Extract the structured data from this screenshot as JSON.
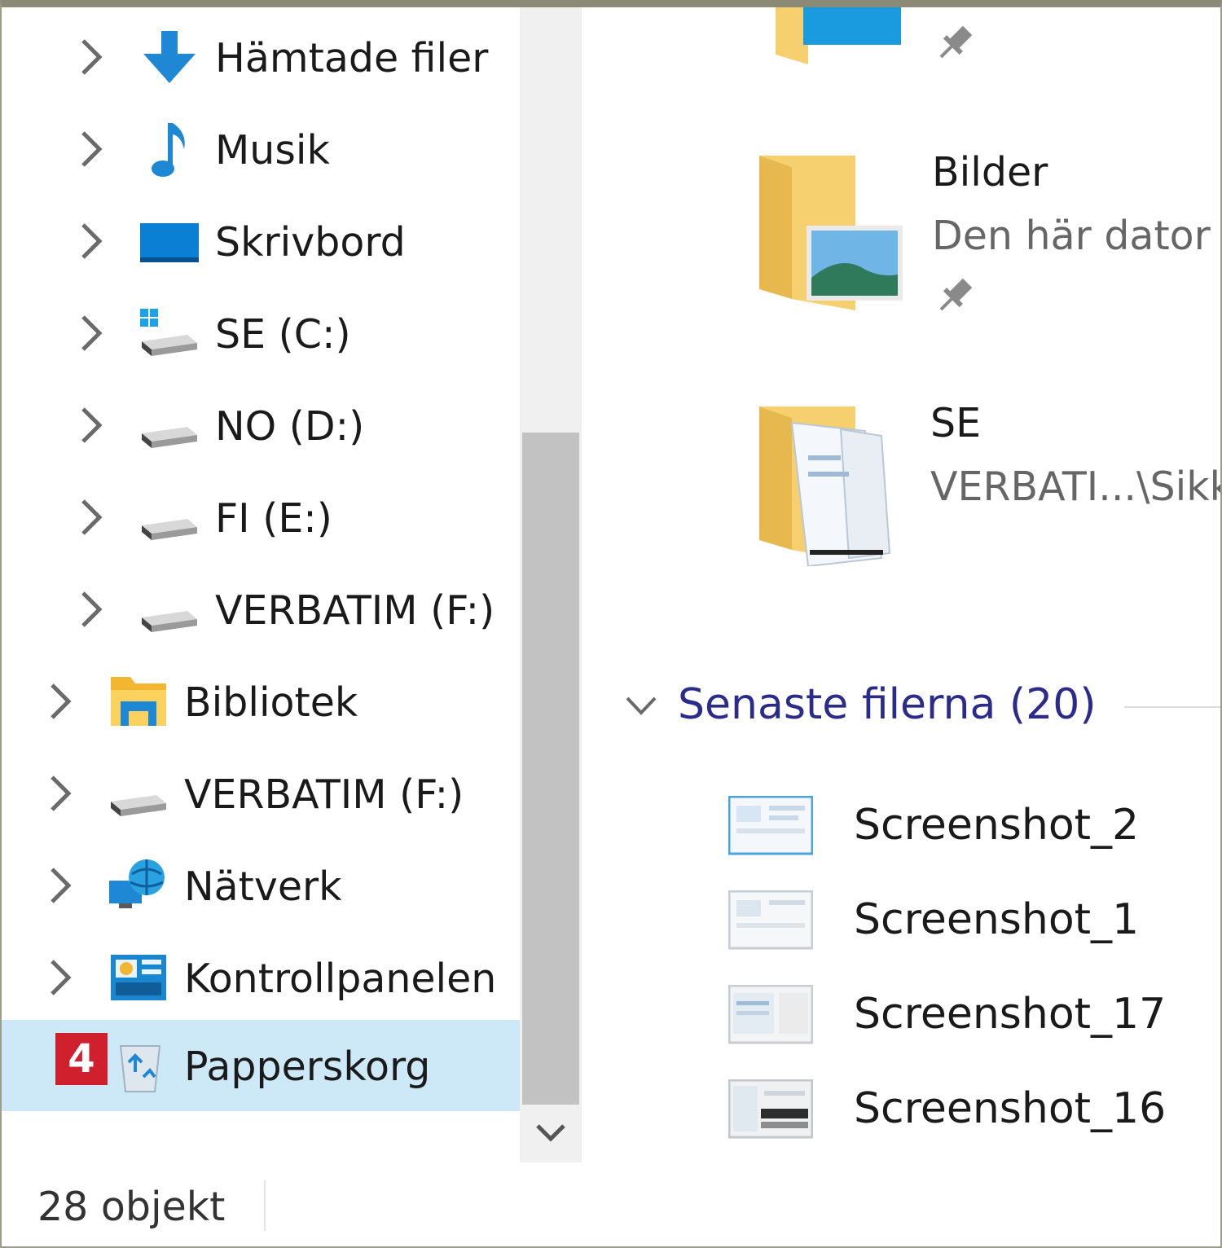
{
  "nav": {
    "items": [
      {
        "label": "Hämtade filer",
        "icon": "downloads-icon"
      },
      {
        "label": "Musik",
        "icon": "music-icon"
      },
      {
        "label": "Skrivbord",
        "icon": "desktop-icon"
      },
      {
        "label": "SE (C:)",
        "icon": "windows-drive-icon"
      },
      {
        "label": "NO (D:)",
        "icon": "drive-icon"
      },
      {
        "label": "FI (E:)",
        "icon": "drive-icon"
      },
      {
        "label": "VERBATIM (F:)",
        "icon": "drive-icon"
      },
      {
        "label": "Bibliotek",
        "icon": "libraries-icon"
      },
      {
        "label": "VERBATIM (F:)",
        "icon": "drive-icon"
      },
      {
        "label": "Nätverk",
        "icon": "network-icon"
      },
      {
        "label": "Kontrollpanelen",
        "icon": "control-panel-icon"
      },
      {
        "label": "Papperskorg",
        "icon": "recycle-bin-icon",
        "selected": true
      }
    ]
  },
  "annotation": {
    "badge": "4"
  },
  "quick_access": [
    {
      "title": "Bilder",
      "subtitle": "Den här dator"
    },
    {
      "title": "SE",
      "subtitle": "VERBATI...\\Sikk"
    }
  ],
  "recent": {
    "header": "Senaste filerna (20)",
    "files": [
      "Screenshot_2",
      "Screenshot_1",
      "Screenshot_17",
      "Screenshot_16"
    ]
  },
  "status": {
    "items_count": "28 objekt"
  },
  "colors": {
    "selection": "#cde8f6",
    "accent": "#0078d7",
    "section_header": "#2b2b8c",
    "badge": "#d0202e"
  }
}
